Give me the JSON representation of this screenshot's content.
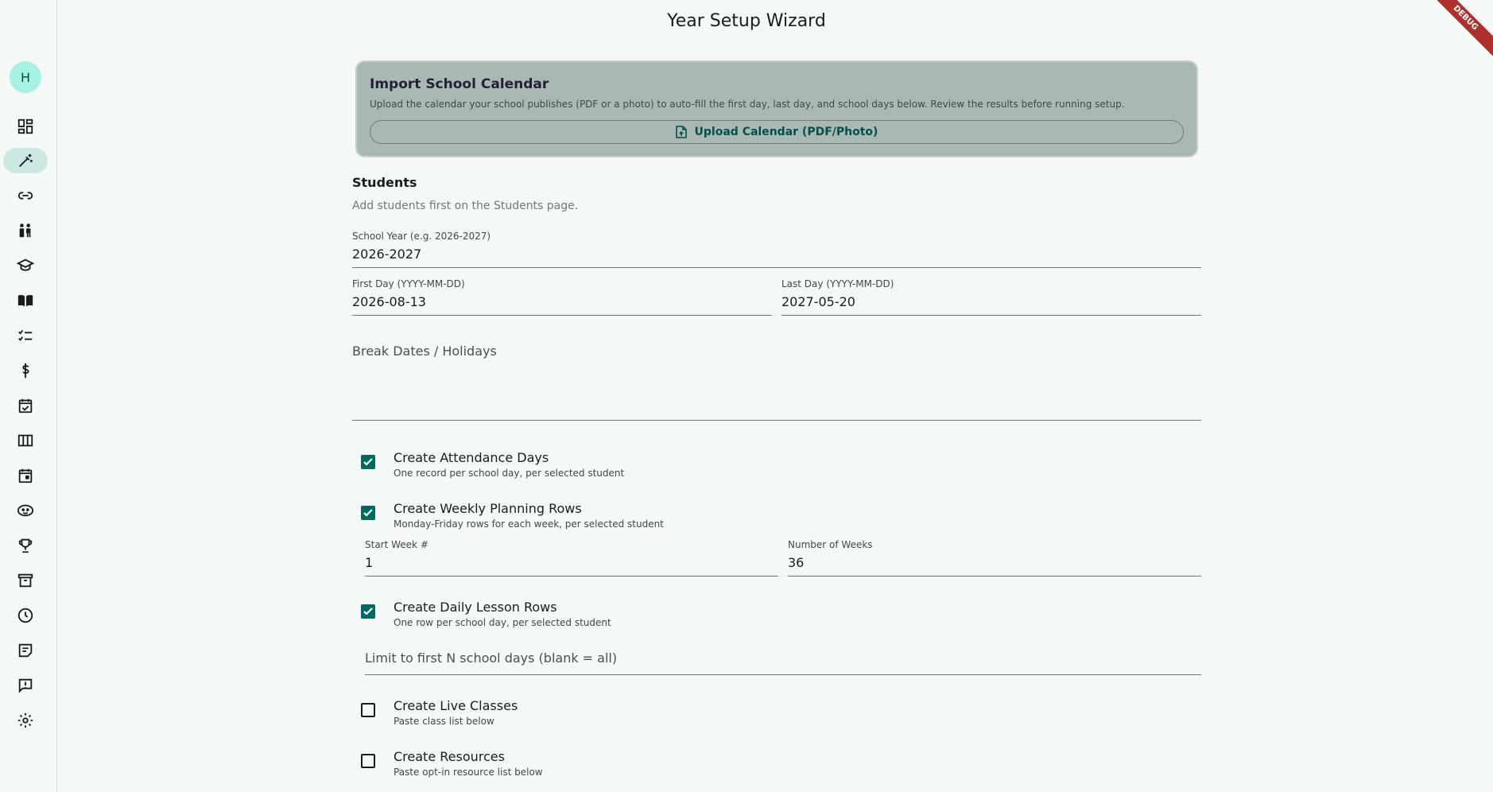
{
  "app": {
    "title": "Year Setup Wizard",
    "debug_banner": "DEBUG",
    "avatar_initial": "H"
  },
  "sidebar": {
    "items": [
      {
        "icon": "dashboard-icon"
      },
      {
        "icon": "magic-wand-icon",
        "active": true
      },
      {
        "icon": "link-icon"
      },
      {
        "icon": "family-icon"
      },
      {
        "icon": "graduation-cap-icon"
      },
      {
        "icon": "book-icon"
      },
      {
        "icon": "checklist-icon"
      },
      {
        "icon": "dollar-icon"
      },
      {
        "icon": "calendar-check-icon"
      },
      {
        "icon": "view-week-icon"
      },
      {
        "icon": "calendar-icon"
      },
      {
        "icon": "face-icon"
      },
      {
        "icon": "trophy-icon"
      },
      {
        "icon": "archive-icon"
      },
      {
        "icon": "clock-icon"
      },
      {
        "icon": "note-icon"
      },
      {
        "icon": "feedback-icon"
      },
      {
        "icon": "settings-icon"
      }
    ]
  },
  "import_calendar": {
    "title": "Import School Calendar",
    "description": "Upload the calendar your school publishes (PDF or a photo) to auto-fill the first day, last day, and school days below. Review the results before running setup.",
    "upload_label": "Upload Calendar (PDF/Photo)"
  },
  "students": {
    "title": "Students",
    "hint": "Add students first on the Students page."
  },
  "school_year": {
    "label": "School Year (e.g. 2026-2027)",
    "value": "2026-2027"
  },
  "first_day": {
    "label": "First Day (YYYY-MM-DD)",
    "value": "2026-08-13"
  },
  "last_day": {
    "label": "Last Day (YYYY-MM-DD)",
    "value": "2027-05-20"
  },
  "break_dates": {
    "placeholder": "Break Dates / Holidays"
  },
  "options": {
    "attendance": {
      "label": "Create Attendance Days",
      "sub": "One record per school day, per selected student",
      "checked": true
    },
    "weekly": {
      "label": "Create Weekly Planning Rows",
      "sub": "Monday-Friday rows for each week, per selected student",
      "checked": true
    },
    "start_week": {
      "label": "Start Week #",
      "value": "1"
    },
    "num_weeks": {
      "label": "Number of Weeks",
      "value": "36"
    },
    "daily": {
      "label": "Create Daily Lesson Rows",
      "sub": "One row per school day, per selected student",
      "checked": true
    },
    "limit": {
      "placeholder": "Limit to first N school days (blank = all)"
    },
    "live_classes": {
      "label": "Create Live Classes",
      "sub": "Paste class list below",
      "checked": false
    },
    "resources": {
      "label": "Create Resources",
      "sub": "Paste opt-in resource list below",
      "checked": false
    }
  },
  "colors": {
    "accent": "#006a61",
    "card": "#aab8b4",
    "background": "#f4f9f7"
  }
}
